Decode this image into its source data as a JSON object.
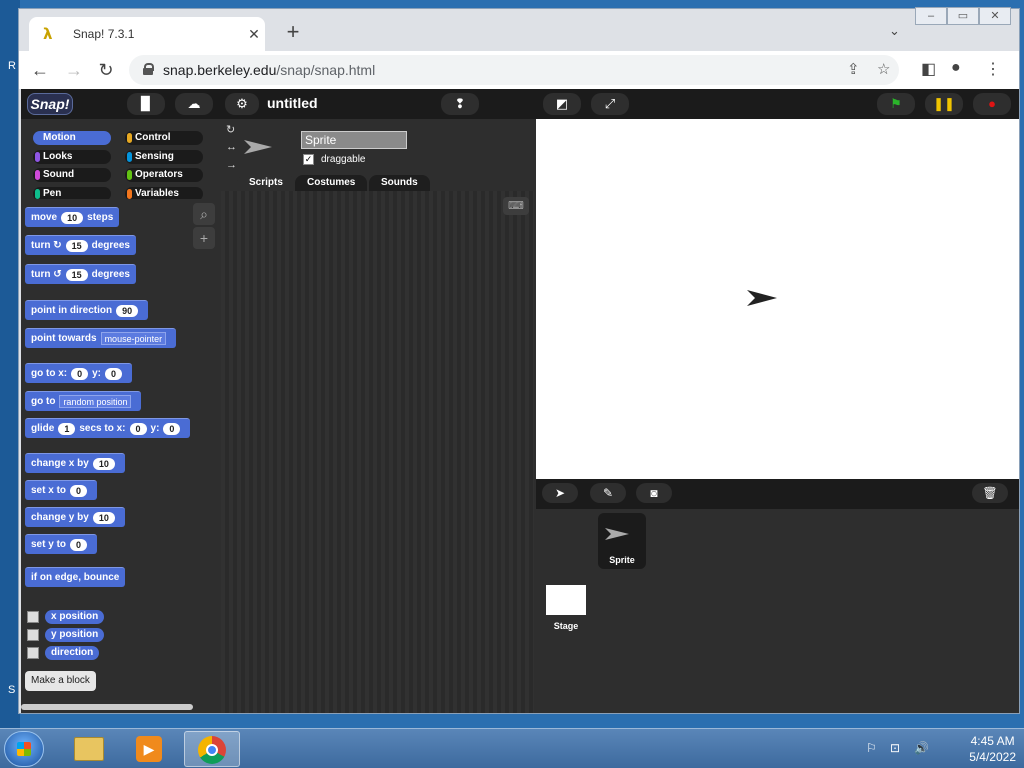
{
  "browser": {
    "tab_title": "Snap! 7.3.1",
    "tab_icon": "lambda-icon",
    "url_host": "snap.berkeley.edu",
    "url_path": "/snap/snap.html"
  },
  "snap": {
    "logo": "Snap!",
    "project_title": "untitled",
    "categories": [
      {
        "label": "Motion",
        "color": "#4a6cd4"
      },
      {
        "label": "Looks",
        "color": "#8f56e3"
      },
      {
        "label": "Sound",
        "color": "#cf4ad9"
      },
      {
        "label": "Pen",
        "color": "#0fbd8c"
      },
      {
        "label": "Control",
        "color": "#e6a822"
      },
      {
        "label": "Sensing",
        "color": "#0494dc"
      },
      {
        "label": "Operators",
        "color": "#62c213"
      },
      {
        "label": "Variables",
        "color": "#f3761d"
      }
    ],
    "blocks": {
      "move": {
        "a": "move",
        "v": "10",
        "b": "steps"
      },
      "turn_cw": {
        "a": "turn",
        "v": "15",
        "b": "degrees"
      },
      "turn_ccw": {
        "a": "turn",
        "v": "15",
        "b": "degrees"
      },
      "point_dir": {
        "a": "point in direction",
        "v": "90"
      },
      "point_towards": {
        "a": "point towards",
        "v": "mouse-pointer"
      },
      "goto_xy": {
        "a": "go to x:",
        "x": "0",
        "b": "y:",
        "y": "0"
      },
      "goto": {
        "a": "go to",
        "v": "random position"
      },
      "glide": {
        "a": "glide",
        "v": "1",
        "b": "secs to x:",
        "x": "0",
        "c": "y:",
        "y": "0"
      },
      "change_x": {
        "a": "change x by",
        "v": "10"
      },
      "set_x": {
        "a": "set x to",
        "v": "0"
      },
      "change_y": {
        "a": "change y by",
        "v": "10"
      },
      "set_y": {
        "a": "set y to",
        "v": "0"
      },
      "bounce": {
        "a": "if on edge, bounce"
      }
    },
    "reporters": [
      "x position",
      "y position",
      "direction"
    ],
    "make_block": "Make a block",
    "sprite_name": "Sprite",
    "draggable_label": "draggable",
    "tabs": [
      "Scripts",
      "Costumes",
      "Sounds"
    ],
    "corral": {
      "sprite_label": "Sprite",
      "stage_label": "Stage"
    }
  },
  "taskbar": {
    "time": "4:45 AM",
    "date": "5/4/2022"
  },
  "colors": {
    "motion": "#4a6cd4",
    "snap_bg": "#2e2e2e",
    "green_flag": "#2ab52a",
    "pause": "#f0c400",
    "stop": "#e01414"
  }
}
